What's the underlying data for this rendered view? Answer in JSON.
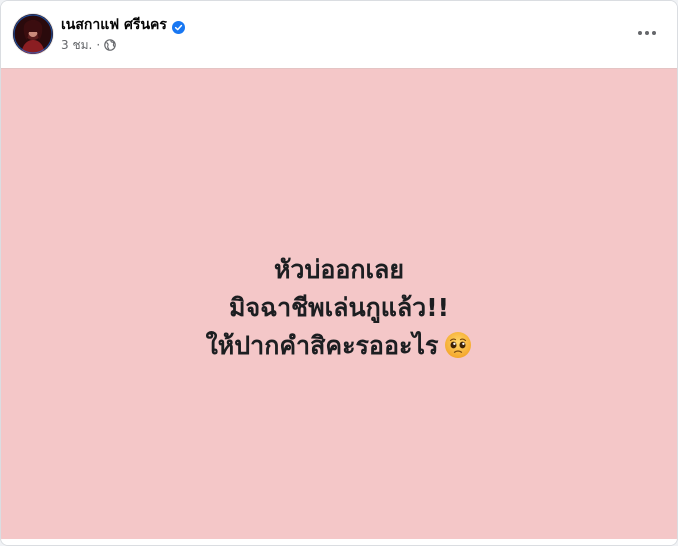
{
  "post": {
    "author": {
      "name": "เนสกาแฟ ศรีนคร",
      "verified": true,
      "avatar_icon": "profile-photo"
    },
    "timestamp": "3 ชม.",
    "separator": "·",
    "audience_icon": "globe-icon",
    "more_icon": "more-options-icon",
    "background_color": "#f4c7c8",
    "text_lines": [
      "หัวบ่ออกเลย",
      "มิจฉาชีพเล่นกูแล้ว!!",
      "ให้ปากคำสิคะรออะไร"
    ],
    "emoji": "pleading-face-emoji"
  }
}
